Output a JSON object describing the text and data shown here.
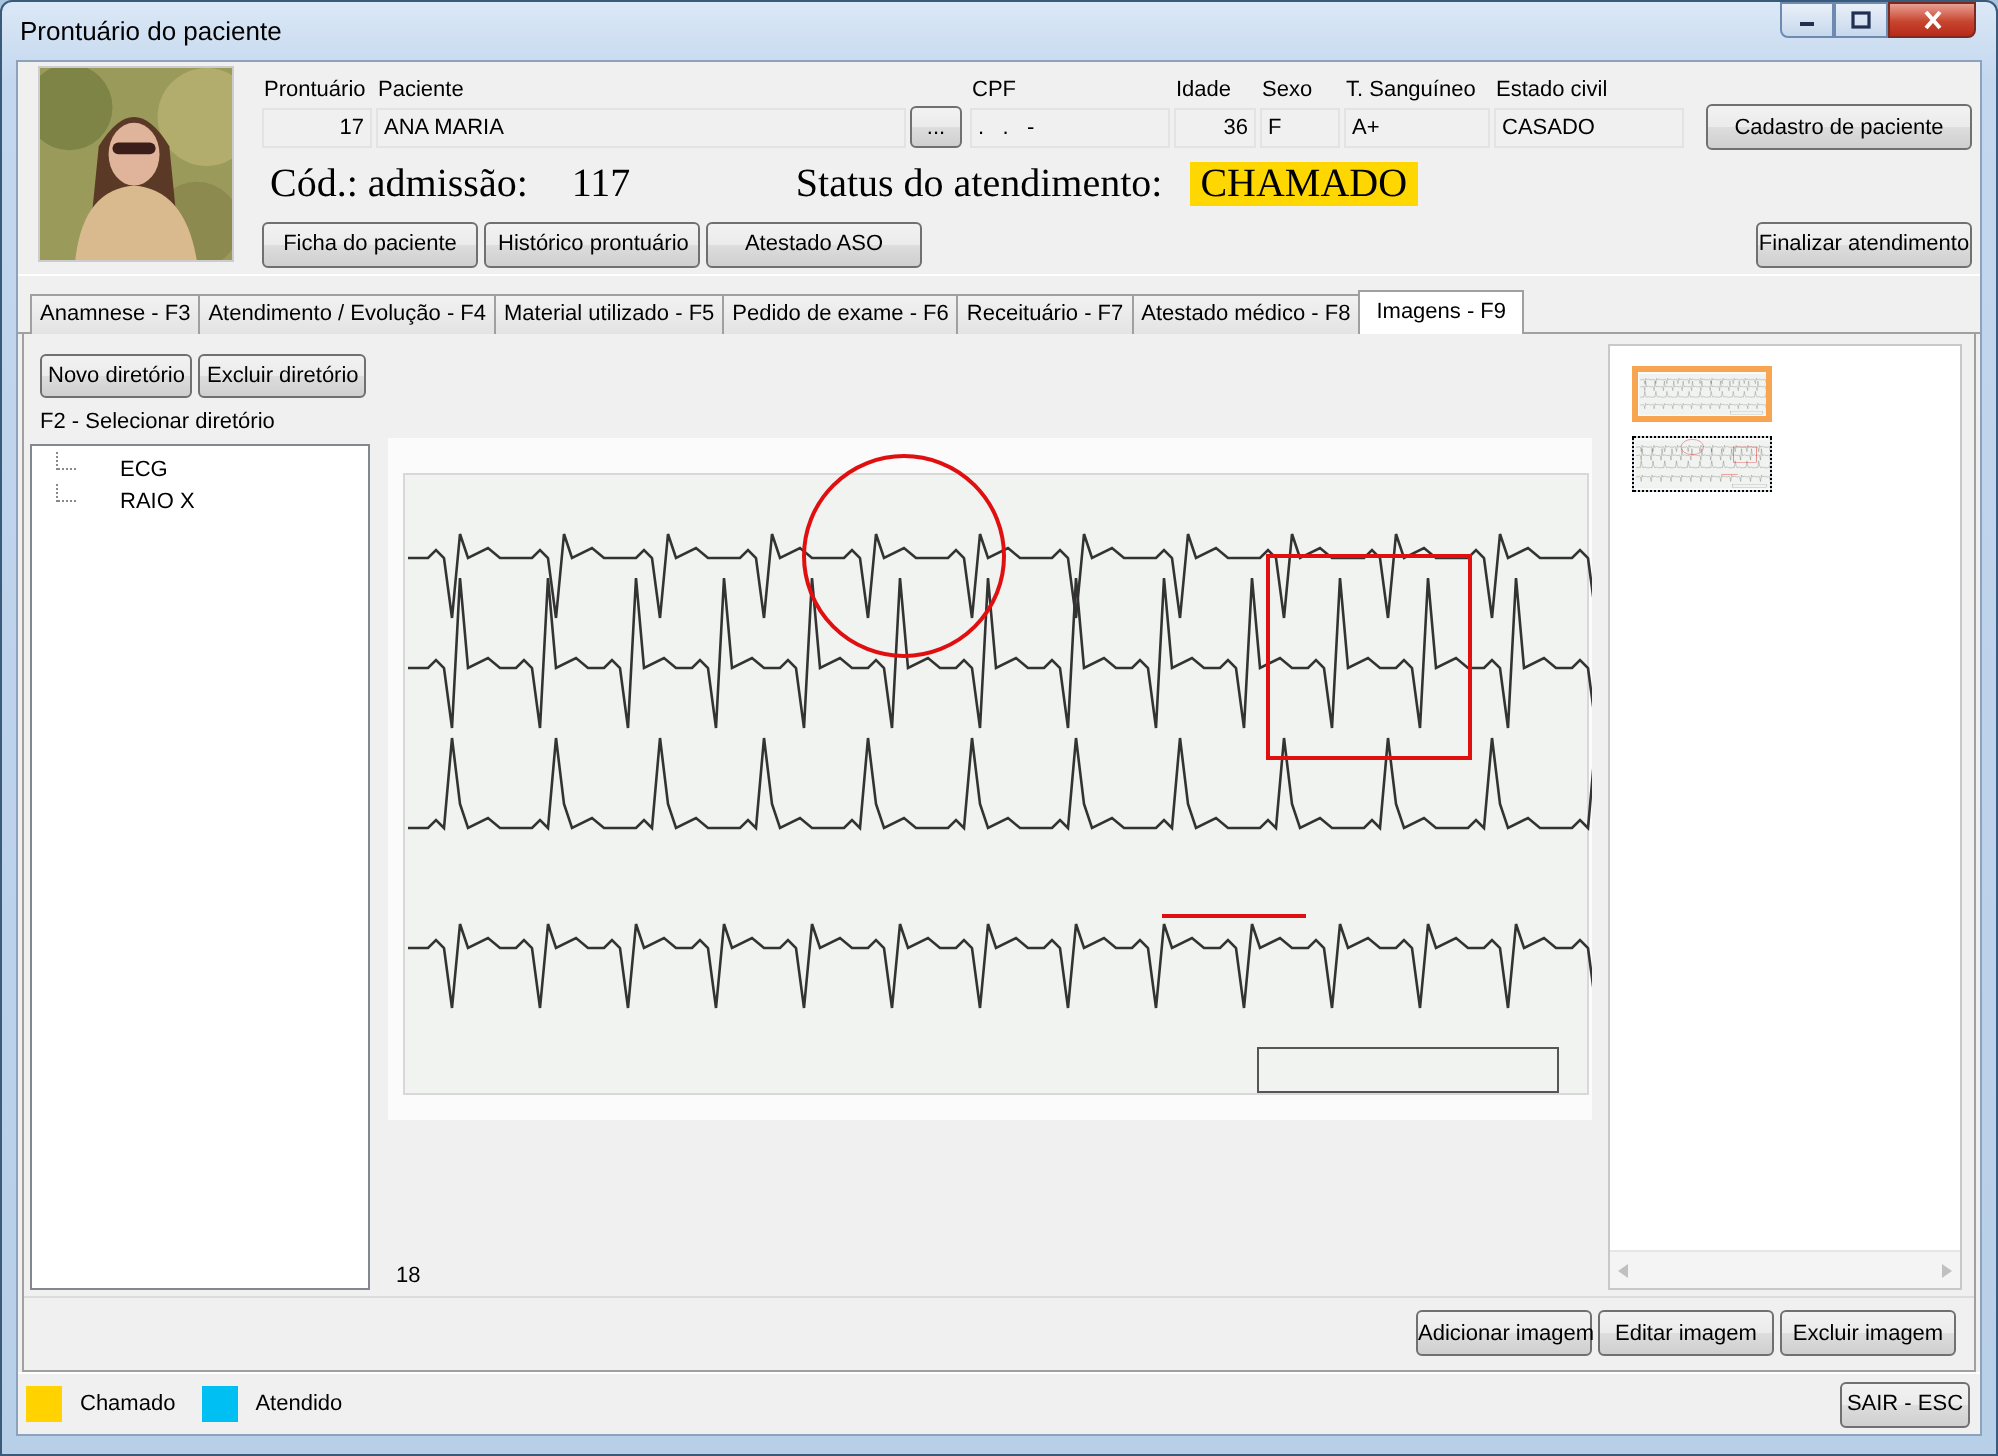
{
  "window": {
    "title": "Prontuário do paciente"
  },
  "patient": {
    "fields": [
      {
        "kind": "field",
        "label": "Prontuário",
        "value": "17",
        "numeric": true
      },
      {
        "kind": "field",
        "label": "Paciente",
        "value": "ANA MARIA",
        "numeric": false
      },
      {
        "kind": "button",
        "label": "..."
      },
      {
        "kind": "field",
        "label": "CPF",
        "value": ".   .   -",
        "numeric": false
      },
      {
        "kind": "field",
        "label": "Idade",
        "value": "36",
        "numeric": true
      },
      {
        "kind": "field",
        "label": "Sexo",
        "value": "F",
        "numeric": false
      },
      {
        "kind": "field",
        "label": "T. Sanguíneo",
        "value": "A+",
        "numeric": false
      },
      {
        "kind": "field",
        "label": "Estado civil",
        "value": "CASADO",
        "numeric": false
      }
    ],
    "register_button": "Cadastro de paciente",
    "admission": {
      "label": "Cód.: admissão:",
      "value": "117"
    },
    "status": {
      "label": "Status do atendimento:",
      "value": "CHAMADO",
      "color": "#ffd700"
    },
    "buttons": [
      "Ficha do paciente",
      "Histórico prontuário",
      "Atestado ASO"
    ],
    "finish_button": "Finalizar atendimento"
  },
  "tabs": [
    {
      "label": "Anamnese - F3",
      "selected": false
    },
    {
      "label": "Atendimento / Evolução - F4",
      "selected": false
    },
    {
      "label": "Material utilizado - F5",
      "selected": false
    },
    {
      "label": "Pedido de exame - F6",
      "selected": false
    },
    {
      "label": "Receituário - F7",
      "selected": false
    },
    {
      "label": "Atestado médico - F8",
      "selected": false
    },
    {
      "label": "Imagens - F9",
      "selected": true
    }
  ],
  "images": {
    "directory_buttons": [
      "Novo diretório",
      "Excluir diretório"
    ],
    "directory_label": "F2 - Selecionar diretório",
    "tree": [
      {
        "label": "ECG"
      },
      {
        "label": "RAIO X"
      }
    ],
    "image_number": "18",
    "thumbnails": [
      {
        "selected": true,
        "focused": false,
        "annotated": false
      },
      {
        "selected": false,
        "focused": true,
        "annotated": true
      }
    ],
    "actions": [
      "Adicionar imagem",
      "Editar imagem",
      "Excluir imagem"
    ]
  },
  "legend": [
    {
      "label": "Chamado",
      "color": "#ffd200"
    },
    {
      "label": "Atendido",
      "color": "#00bff3"
    }
  ],
  "exit_button": "SAIR - ESC"
}
